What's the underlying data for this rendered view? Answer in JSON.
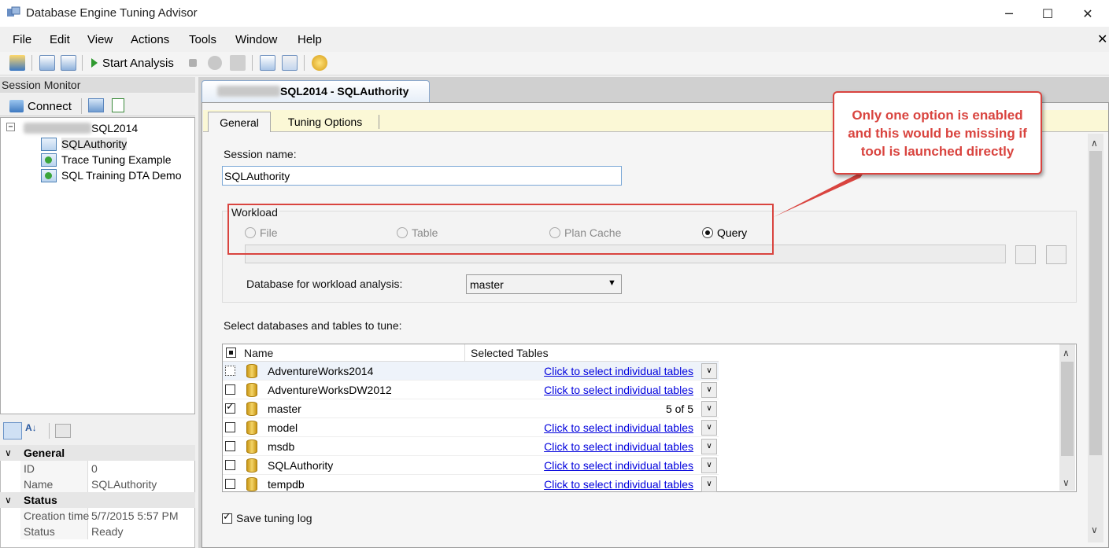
{
  "window": {
    "title": "Database Engine Tuning Advisor",
    "minimize": "─",
    "maximize": "☐",
    "close": "✕",
    "mdi_close": "✕"
  },
  "menu": [
    "File",
    "Edit",
    "View",
    "Actions",
    "Tools",
    "Window",
    "Help"
  ],
  "toolbar": {
    "start_analysis": "Start Analysis"
  },
  "session_monitor": {
    "title": "Session Monitor",
    "connect": "Connect",
    "expander": "−",
    "server": "SQL2014",
    "sessions": [
      "SQLAuthority",
      "Trace Tuning Example",
      "SQL Training DTA Demo"
    ]
  },
  "properties": {
    "general": {
      "label": "General",
      "id_label": "ID",
      "id_value": "0",
      "name_label": "Name",
      "name_value": "SQLAuthority"
    },
    "status": {
      "label": "Status",
      "creation_label": "Creation time",
      "creation_value": "5/7/2015 5:57 PM",
      "status_label": "Status",
      "status_value": "Ready"
    }
  },
  "document_tab": {
    "title": "SQL2014 - SQLAuthority"
  },
  "inner_tabs": {
    "general": "General",
    "tuning": "Tuning Options"
  },
  "general_tab": {
    "session_name_label": "Session name:",
    "session_name_value": "SQLAuthority",
    "workload": {
      "label": "Workload",
      "options": [
        {
          "label": "File",
          "selected": false,
          "enabled": false
        },
        {
          "label": "Table",
          "selected": false,
          "enabled": false
        },
        {
          "label": "Plan Cache",
          "selected": false,
          "enabled": false
        },
        {
          "label": "Query",
          "selected": true,
          "enabled": true
        }
      ],
      "db_label": "Database for workload analysis:",
      "db_value": "master"
    },
    "select_label": "Select databases and tables to tune:",
    "grid": {
      "col_name": "Name",
      "col_tables": "Selected Tables",
      "rows": [
        {
          "name": "AdventureWorks2014",
          "checked": false,
          "tables": "Click to select individual tables",
          "link": true
        },
        {
          "name": "AdventureWorksDW2012",
          "checked": false,
          "tables": "Click to select individual tables",
          "link": true
        },
        {
          "name": "master",
          "checked": true,
          "tables": "5 of 5",
          "link": false
        },
        {
          "name": "model",
          "checked": false,
          "tables": "Click to select individual tables",
          "link": true
        },
        {
          "name": "msdb",
          "checked": false,
          "tables": "Click to select individual tables",
          "link": true
        },
        {
          "name": "SQLAuthority",
          "checked": false,
          "tables": "Click to select individual tables",
          "link": true
        },
        {
          "name": "tempdb",
          "checked": false,
          "tables": "Click to select individual tables",
          "link": true
        }
      ]
    },
    "save_log_label": "Save tuning log"
  },
  "callout": {
    "text": "Only one option is enabled and this would be missing if tool is launched directly"
  },
  "colors": {
    "callout": "#d9443f",
    "link": "#0000dd"
  }
}
